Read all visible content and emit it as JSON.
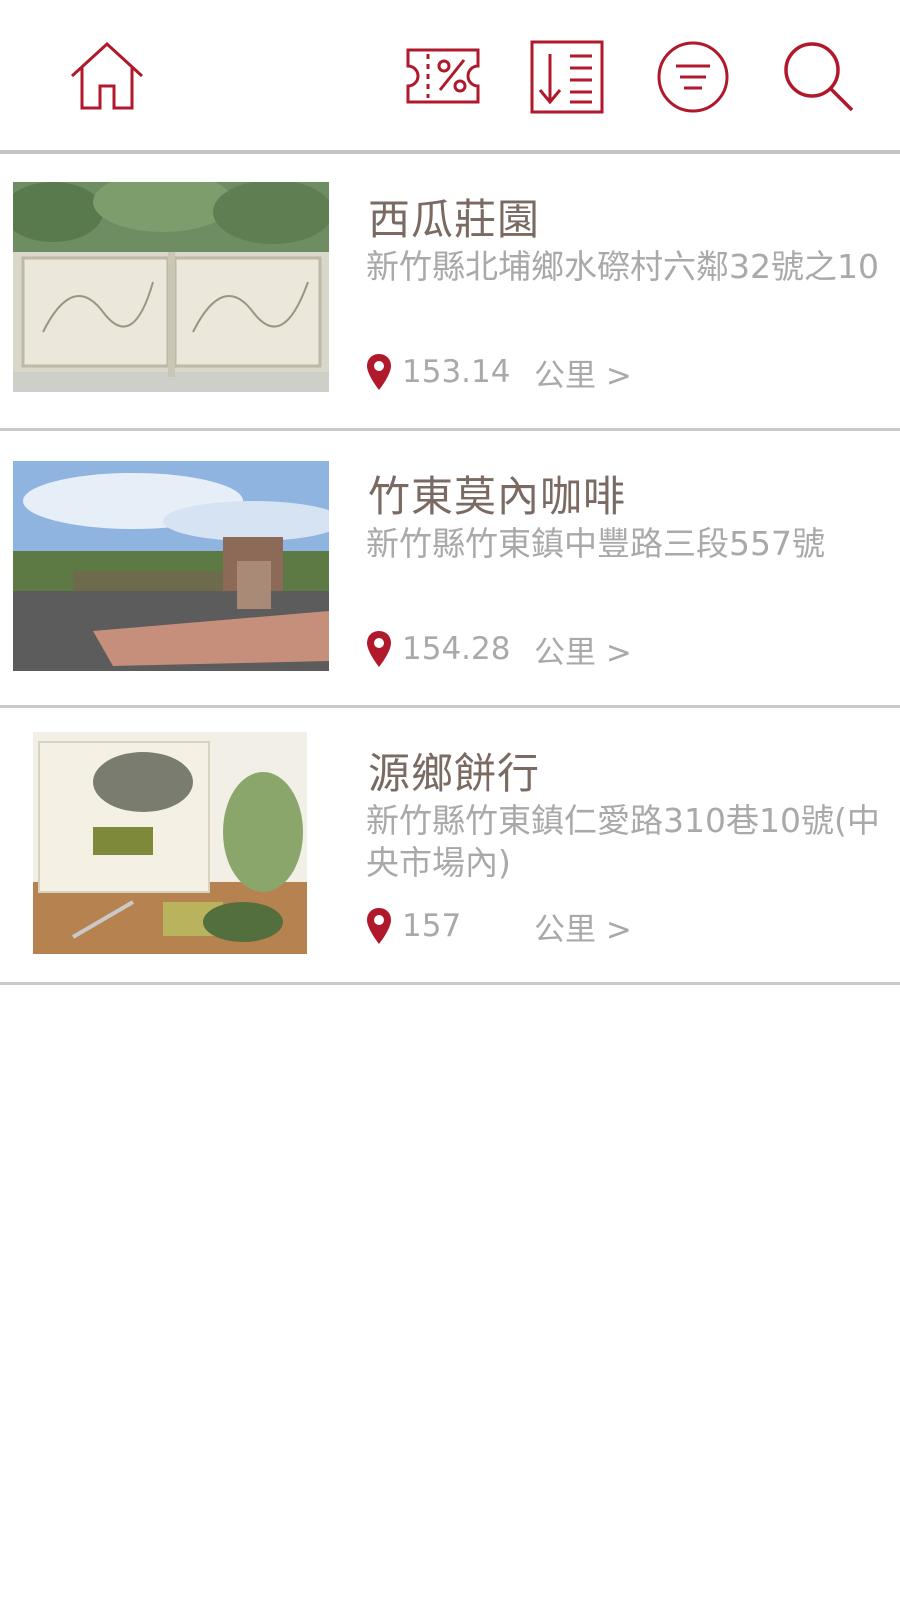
{
  "toolbar": {
    "icons": [
      "home-icon",
      "coupon-icon",
      "sort-icon",
      "menu-icon",
      "search-icon"
    ],
    "accent_color": "#b0192b"
  },
  "stores": [
    {
      "name": "西瓜莊園",
      "address": "新竹縣北埔鄉水磜村六鄰32號之10",
      "distance": "153.14",
      "unit": "公里 >"
    },
    {
      "name": "竹東莫內咖啡",
      "address": "新竹縣竹東鎮中豐路三段557號",
      "distance": "154.28",
      "unit": "公里 >"
    },
    {
      "name": "源鄉餅行",
      "address": "新竹縣竹東鎮仁愛路310巷10號(中央市場內)",
      "distance": "157",
      "unit": "公里 >"
    }
  ]
}
